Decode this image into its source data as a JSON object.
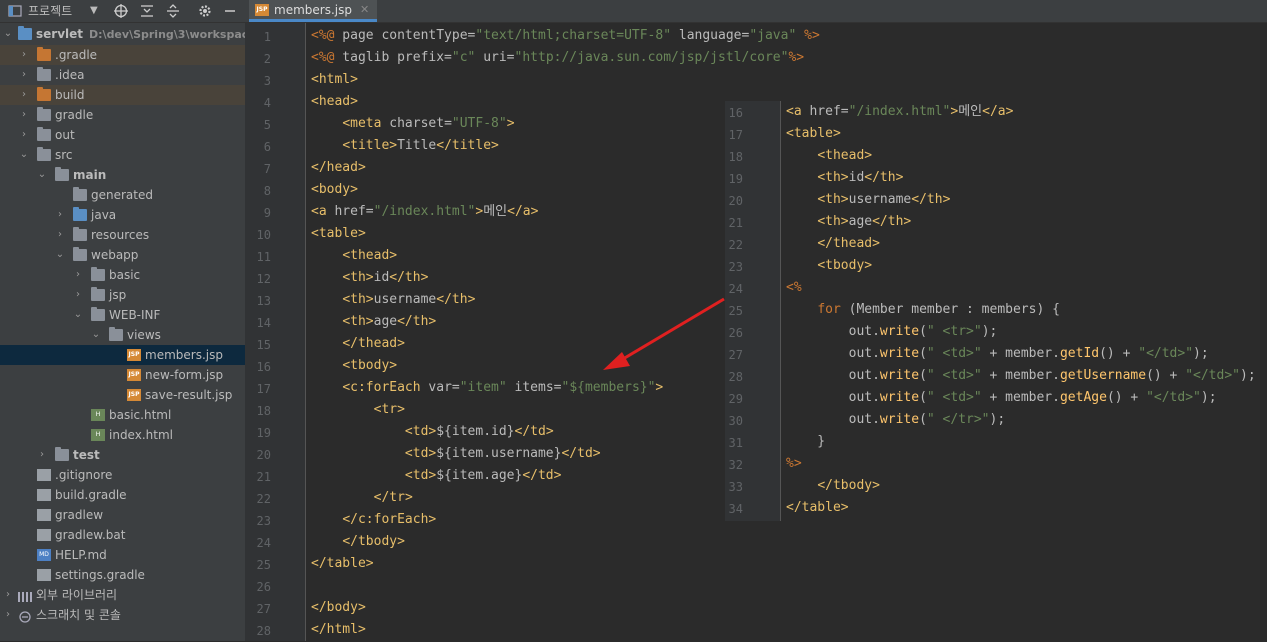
{
  "sidebar": {
    "header": {
      "title": "프로젝트"
    },
    "project": {
      "name": "servlet",
      "path": "D:\\dev\\Spring\\3\\workspace"
    },
    "items": [
      {
        "label": ".gradle"
      },
      {
        "label": ".idea"
      },
      {
        "label": "build"
      },
      {
        "label": "gradle"
      },
      {
        "label": "out"
      },
      {
        "label": "src"
      },
      {
        "label": "main"
      },
      {
        "label": "generated"
      },
      {
        "label": "java"
      },
      {
        "label": "resources"
      },
      {
        "label": "webapp"
      },
      {
        "label": "basic"
      },
      {
        "label": "jsp"
      },
      {
        "label": "WEB-INF"
      },
      {
        "label": "views"
      },
      {
        "label": "members.jsp"
      },
      {
        "label": "new-form.jsp"
      },
      {
        "label": "save-result.jsp"
      },
      {
        "label": "basic.html"
      },
      {
        "label": "index.html"
      },
      {
        "label": "test"
      },
      {
        "label": ".gitignore"
      },
      {
        "label": "build.gradle"
      },
      {
        "label": "gradlew"
      },
      {
        "label": "gradlew.bat"
      },
      {
        "label": "HELP.md"
      },
      {
        "label": "settings.gradle"
      },
      {
        "label": "외부 라이브러리"
      },
      {
        "label": "스크래치 및 콘솔"
      }
    ]
  },
  "tab": {
    "label": "members.jsp"
  },
  "editor": {
    "lines": [
      "<%@ page contentType=\"text/html;charset=UTF-8\" language=\"java\" %>",
      "<%@ taglib prefix=\"c\" uri=\"http://java.sun.com/jsp/jstl/core\"%>",
      "<html>",
      "<head>",
      "    <meta charset=\"UTF-8\">",
      "    <title>Title</title>",
      "</head>",
      "<body>",
      "<a href=\"/index.html\">메인</a>",
      "<table>",
      "    <thead>",
      "    <th>id</th>",
      "    <th>username</th>",
      "    <th>age</th>",
      "    </thead>",
      "    <tbody>",
      "    <c:forEach var=\"item\" items=\"${members}\">",
      "        <tr>",
      "            <td>${item.id}</td>",
      "            <td>${item.username}</td>",
      "            <td>${item.age}</td>",
      "        </tr>",
      "    </c:forEach>",
      "    </tbody>",
      "</table>",
      "",
      "</body>",
      "</html>"
    ]
  },
  "overlay": {
    "lines": [
      {
        "n": "16",
        "text": "<a href=\"/index.html\">메인</a>"
      },
      {
        "n": "17",
        "text": "<table>"
      },
      {
        "n": "18",
        "text": "    <thead>"
      },
      {
        "n": "19",
        "text": "    <th>id</th>"
      },
      {
        "n": "20",
        "text": "    <th>username</th>"
      },
      {
        "n": "21",
        "text": "    <th>age</th>"
      },
      {
        "n": "22",
        "text": "    </thead>"
      },
      {
        "n": "23",
        "text": "    <tbody>"
      },
      {
        "n": "24",
        "text": "<%"
      },
      {
        "n": "25",
        "text": "    for (Member member : members) {"
      },
      {
        "n": "26",
        "text": "        out.write(\" <tr>\");"
      },
      {
        "n": "27",
        "text": "        out.write(\" <td>\" + member.getId() + \"</td>\");"
      },
      {
        "n": "28",
        "text": "        out.write(\" <td>\" + member.getUsername() + \"</td>\");"
      },
      {
        "n": "29",
        "text": "        out.write(\" <td>\" + member.getAge() + \"</td>\");"
      },
      {
        "n": "30",
        "text": "        out.write(\" </tr>\");"
      },
      {
        "n": "31",
        "text": "    }"
      },
      {
        "n": "32",
        "text": "%>"
      },
      {
        "n": "33",
        "text": "    </tbody>"
      },
      {
        "n": "34",
        "text": "</table>"
      }
    ]
  },
  "colors": {
    "arrow": "#e02020",
    "selection": "#0d293e",
    "accent": "#4a88c7"
  }
}
